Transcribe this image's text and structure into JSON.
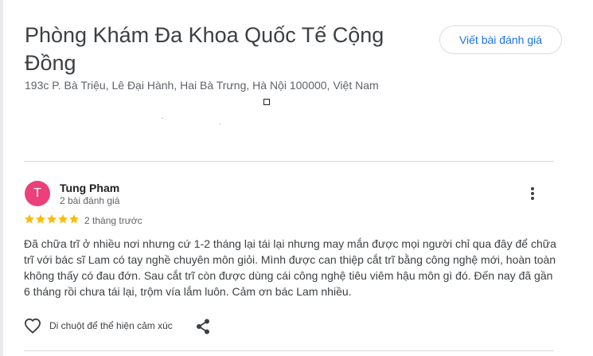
{
  "place": {
    "title": "Phòng Khám Đa Khoa Quốc Tế Cộng Đồng",
    "address": "193c P. Bà Triệu, Lê Đại Hành, Hai Bà Trưng, Hà Nội 100000, Việt Nam"
  },
  "actions": {
    "write_review_label": "Viết bài đánh giá"
  },
  "review": {
    "avatar_letter": "T",
    "avatar_color": "#ec407a",
    "reviewer_name": "Tung Pham",
    "reviewer_review_count": "2 bài đánh giá",
    "rating": 5,
    "rating_max": 5,
    "star_color": "#fbbc04",
    "time": "2 tháng trước",
    "text": "Đã chữa trĩ ở nhiều nơi nhưng cứ 1-2 tháng lại tái lại nhưng may mắn được mọi người chỉ qua đây để chữa trĩ với bác sĩ Lam có tay nghề chuyên môn giỏi. Mình được can thiệp cắt trĩ bằng công nghệ mới, hoàn toàn không thấy có đau đớn. Sau cắt trĩ còn được dùng cái công nghệ tiêu viêm hậu môn gì đó. Đến nay đã gần 6 tháng rồi chưa tái lại, trộm vía lắm luôn. Cảm ơn bác Lam nhiều.",
    "like_label": "Di chuột để thể hiện cảm xúc",
    "icons": {
      "more": "more-vert-icon",
      "like": "heart-icon",
      "share": "share-icon"
    }
  }
}
